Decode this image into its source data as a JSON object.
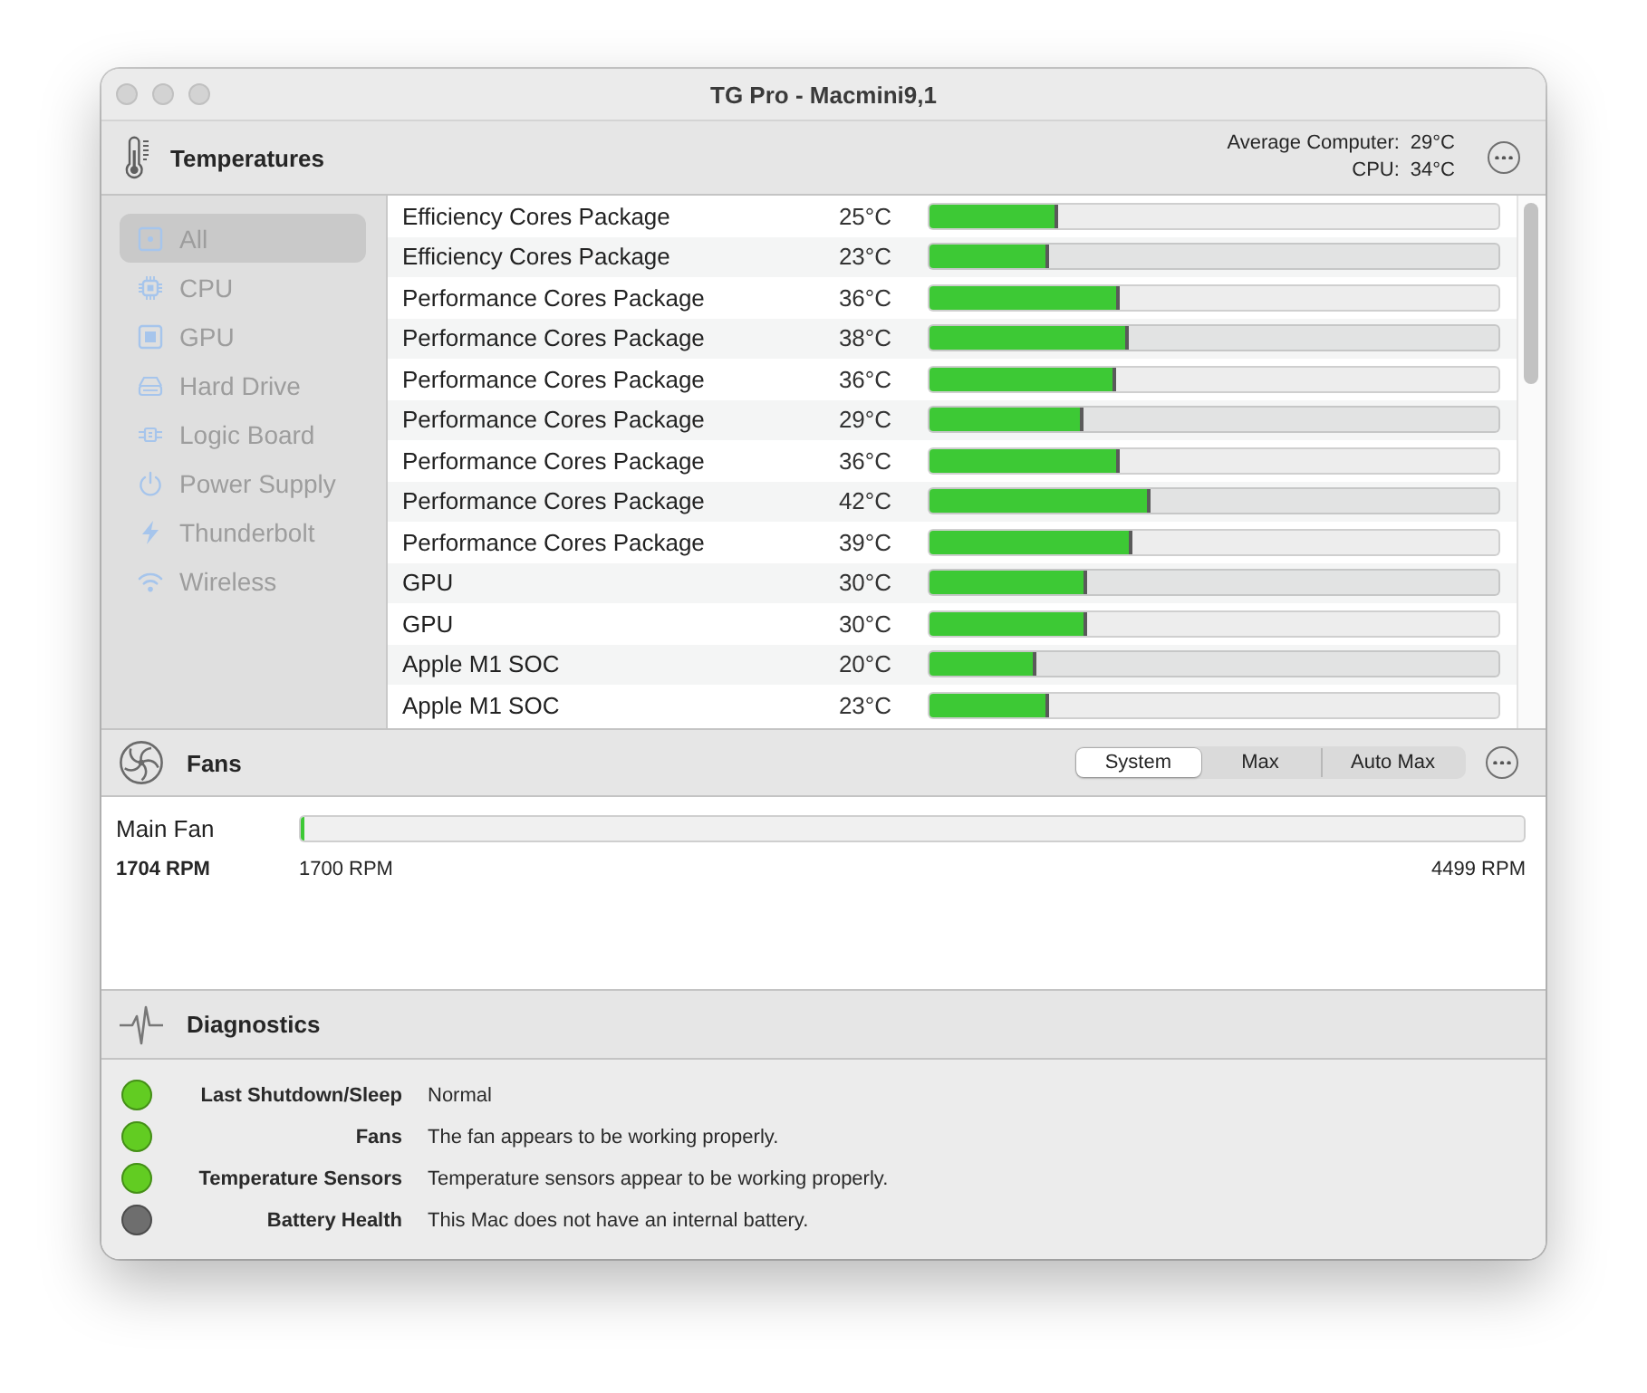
{
  "window": {
    "title": "TG Pro - Macmini9,1"
  },
  "temperatures": {
    "title": "Temperatures",
    "summary": [
      {
        "label": "Average Computer:",
        "value": "29°C"
      },
      {
        "label": "CPU:",
        "value": "34°C"
      }
    ]
  },
  "sidebar": {
    "items": [
      {
        "label": "All",
        "selected": true
      },
      {
        "label": "CPU",
        "selected": false
      },
      {
        "label": "GPU",
        "selected": false
      },
      {
        "label": "Hard Drive",
        "selected": false
      },
      {
        "label": "Logic Board",
        "selected": false
      },
      {
        "label": "Power Supply",
        "selected": false
      },
      {
        "label": "Thunderbolt",
        "selected": false
      },
      {
        "label": "Wireless",
        "selected": false
      }
    ]
  },
  "sensors": [
    {
      "name": "Efficiency Cores Package",
      "reading": "25°C",
      "level": 0.225
    },
    {
      "name": "Efficiency Cores Package",
      "reading": "23°C",
      "level": 0.21
    },
    {
      "name": "Performance Cores Package",
      "reading": "36°C",
      "level": 0.334
    },
    {
      "name": "Performance Cores Package",
      "reading": "38°C",
      "level": 0.35
    },
    {
      "name": "Performance Cores Package",
      "reading": "36°C",
      "level": 0.327
    },
    {
      "name": "Performance Cores Package",
      "reading": "29°C",
      "level": 0.27
    },
    {
      "name": "Performance Cores Package",
      "reading": "36°C",
      "level": 0.334
    },
    {
      "name": "Performance Cores Package",
      "reading": "42°C",
      "level": 0.387
    },
    {
      "name": "Performance Cores Package",
      "reading": "39°C",
      "level": 0.356
    },
    {
      "name": "GPU",
      "reading": "30°C",
      "level": 0.276
    },
    {
      "name": "GPU",
      "reading": "30°C",
      "level": 0.276
    },
    {
      "name": "Apple M1 SOC",
      "reading": "20°C",
      "level": 0.187
    },
    {
      "name": "Apple M1 SOC",
      "reading": "23°C",
      "level": 0.21
    }
  ],
  "fans": {
    "title": "Fans",
    "modes": [
      {
        "label": "System",
        "selected": true
      },
      {
        "label": "Max",
        "selected": false
      },
      {
        "label": "Auto Max",
        "selected": false
      }
    ],
    "items": [
      {
        "name": "Main Fan",
        "level": 0.003,
        "speed": "1704 RPM",
        "min": "1700 RPM",
        "max": "4499 RPM"
      }
    ]
  },
  "diagnostics": {
    "title": "Diagnostics",
    "items": [
      {
        "label": "Last Shutdown/Sleep",
        "value": "Normal",
        "color": "#62cc22"
      },
      {
        "label": "Fans",
        "value": "The fan appears to be working properly.",
        "color": "#62cc22"
      },
      {
        "label": "Temperature Sensors",
        "value": "Temperature sensors appear to be working properly.",
        "color": "#62cc22"
      },
      {
        "label": "Battery Health",
        "value": "This Mac does not have an internal battery.",
        "color": "#6e6e6e"
      }
    ]
  }
}
